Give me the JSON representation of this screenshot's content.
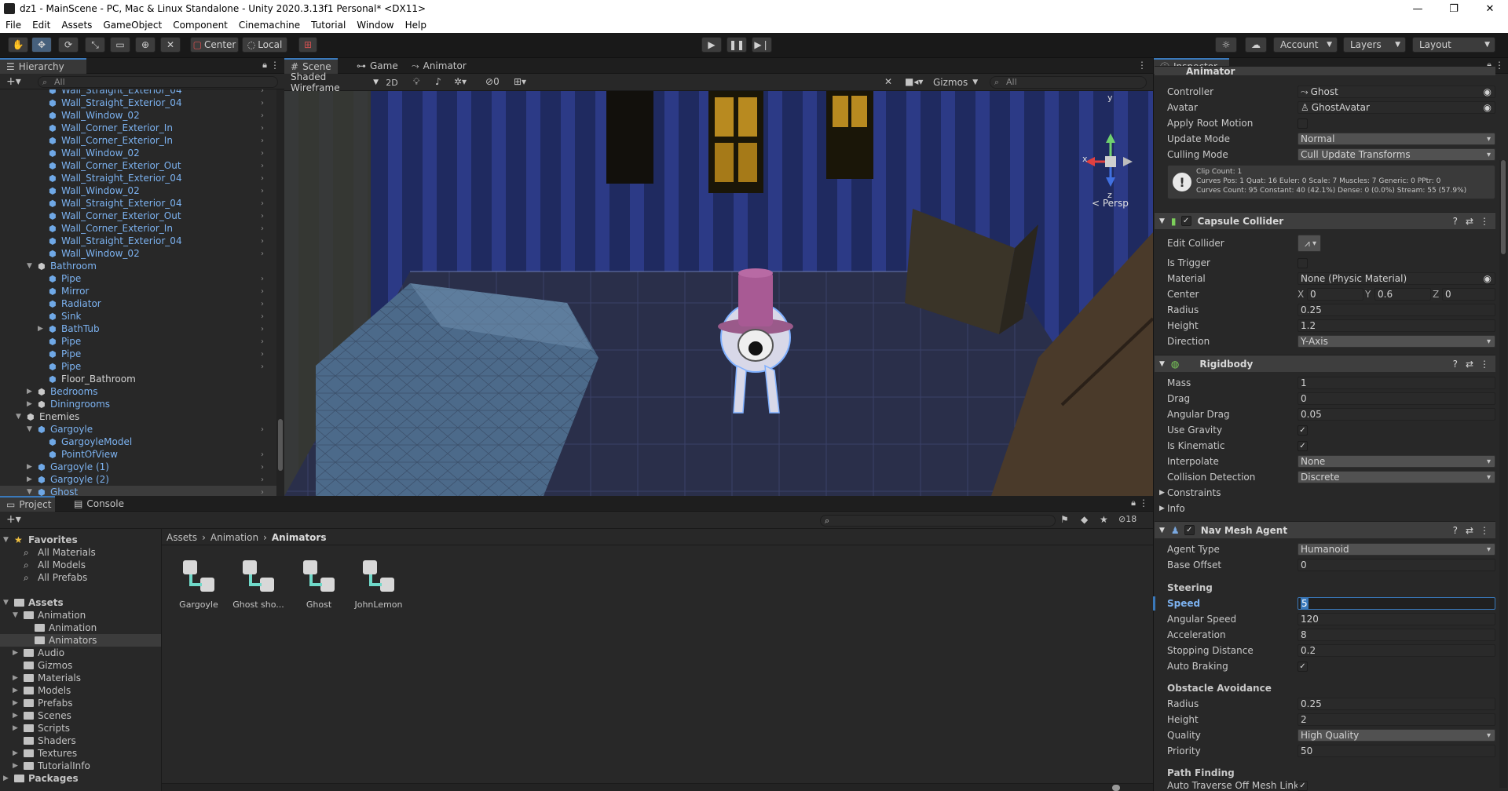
{
  "window": {
    "title": "dz1 - MainScene - PC, Mac & Linux Standalone - Unity 2020.3.13f1 Personal* <DX11>",
    "min": "—",
    "max": "❐",
    "close": "✕"
  },
  "menu": [
    "File",
    "Edit",
    "Assets",
    "GameObject",
    "Component",
    "Cinemachine",
    "Tutorial",
    "Window",
    "Help"
  ],
  "toolbar": {
    "pivot": "Center",
    "space": "Local",
    "account": "Account",
    "layers": "Layers",
    "layout": "Layout"
  },
  "hierarchy": {
    "tab": "Hierarchy",
    "search_placeholder": "All",
    "rows": [
      "Wall_Straight_Exterior_04",
      "Wall_Straight_Exterior_04",
      "Wall_Window_02",
      "Wall_Corner_Exterior_In",
      "Wall_Corner_Exterior_In",
      "Wall_Window_02",
      "Wall_Corner_Exterior_Out",
      "Wall_Straight_Exterior_04",
      "Wall_Window_02",
      "Wall_Straight_Exterior_04",
      "Wall_Corner_Exterior_Out",
      "Wall_Corner_Exterior_In",
      "Wall_Straight_Exterior_04",
      "Wall_Window_02",
      "Bathroom",
      "Pipe",
      "Mirror",
      "Radiator",
      "Sink",
      "BathTub",
      "Pipe",
      "Pipe",
      "Pipe",
      "Floor_Bathroom",
      "Bedrooms",
      "Diningrooms",
      "Enemies",
      "Gargoyle",
      "GargoyleModel",
      "PointOfView",
      "Gargoyle (1)",
      "Gargoyle (2)",
      "Ghost"
    ]
  },
  "scene": {
    "tabs": [
      "Scene",
      "Game",
      "Animator"
    ],
    "shading": "Shaded Wireframe",
    "mode2d": "2D",
    "hidden_count": "0",
    "gizmos": "Gizmos",
    "search_placeholder": "All",
    "persp": "< Persp",
    "axis_x": "x",
    "axis_y": "y",
    "axis_z": "z"
  },
  "project": {
    "tabs": [
      "Project",
      "Console"
    ],
    "count": "18",
    "breadcrumb": [
      "Assets",
      "Animation",
      "Animators"
    ],
    "favorites_title": "Favorites",
    "favorites": [
      "All Materials",
      "All Models",
      "All Prefabs"
    ],
    "assets_title": "Assets",
    "tree": [
      "Animation",
      "Animation",
      "Animators",
      "Audio",
      "Gizmos",
      "Materials",
      "Models",
      "Prefabs",
      "Scenes",
      "Scripts",
      "Shaders",
      "Textures",
      "TutorialInfo"
    ],
    "packages": "Packages",
    "items": [
      "Gargoyle",
      "Ghost sho...",
      "Ghost",
      "JohnLemon"
    ]
  },
  "inspector": {
    "tab": "Inspector",
    "animator": {
      "title": "Animator",
      "controller_label": "Controller",
      "controller": "Ghost",
      "avatar_label": "Avatar",
      "avatar": "GhostAvatar",
      "root_motion_label": "Apply Root Motion",
      "update_mode_label": "Update Mode",
      "update_mode": "Normal",
      "culling_label": "Culling Mode",
      "culling": "Cull Update Transforms",
      "info1": "Clip Count: 1",
      "info2": "Curves Pos: 1 Quat: 16 Euler: 0 Scale: 7 Muscles: 7 Generic: 0 PPtr: 0",
      "info3": "Curves Count: 95 Constant: 40 (42.1%) Dense: 0 (0.0%) Stream: 55 (57.9%)"
    },
    "capsule": {
      "title": "Capsule Collider",
      "edit_label": "Edit Collider",
      "trigger_label": "Is Trigger",
      "material_label": "Material",
      "material": "None (Physic Material)",
      "center_label": "Center",
      "cx": "0",
      "cy": "0.6",
      "cz": "0",
      "radius_label": "Radius",
      "radius": "0.25",
      "height_label": "Height",
      "height": "1.2",
      "direction_label": "Direction",
      "direction": "Y-Axis"
    },
    "rigidbody": {
      "title": "Rigidbody",
      "mass_label": "Mass",
      "mass": "1",
      "drag_label": "Drag",
      "drag": "0",
      "angdrag_label": "Angular Drag",
      "angdrag": "0.05",
      "gravity_label": "Use Gravity",
      "kinematic_label": "Is Kinematic",
      "interp_label": "Interpolate",
      "interp": "None",
      "collision_label": "Collision Detection",
      "collision": "Discrete",
      "constraints_label": "Constraints",
      "info_label": "Info"
    },
    "navmesh": {
      "title": "Nav Mesh Agent",
      "agent_type_label": "Agent Type",
      "agent_type": "Humanoid",
      "base_offset_label": "Base Offset",
      "base_offset": "0",
      "steering": "Steering",
      "speed_label": "Speed",
      "speed": "5",
      "angspeed_label": "Angular Speed",
      "angspeed": "120",
      "accel_label": "Acceleration",
      "accel": "8",
      "stopdist_label": "Stopping Distance",
      "stopdist": "0.2",
      "braking_label": "Auto Braking",
      "obstacle": "Obstacle Avoidance",
      "oradius_label": "Radius",
      "oradius": "0.25",
      "oheight_label": "Height",
      "oheight": "2",
      "quality_label": "Quality",
      "quality": "High Quality",
      "priority_label": "Priority",
      "priority": "50",
      "pathfinding": "Path Finding",
      "autotraverse_label": "Auto Traverse Off Mesh Link"
    }
  }
}
